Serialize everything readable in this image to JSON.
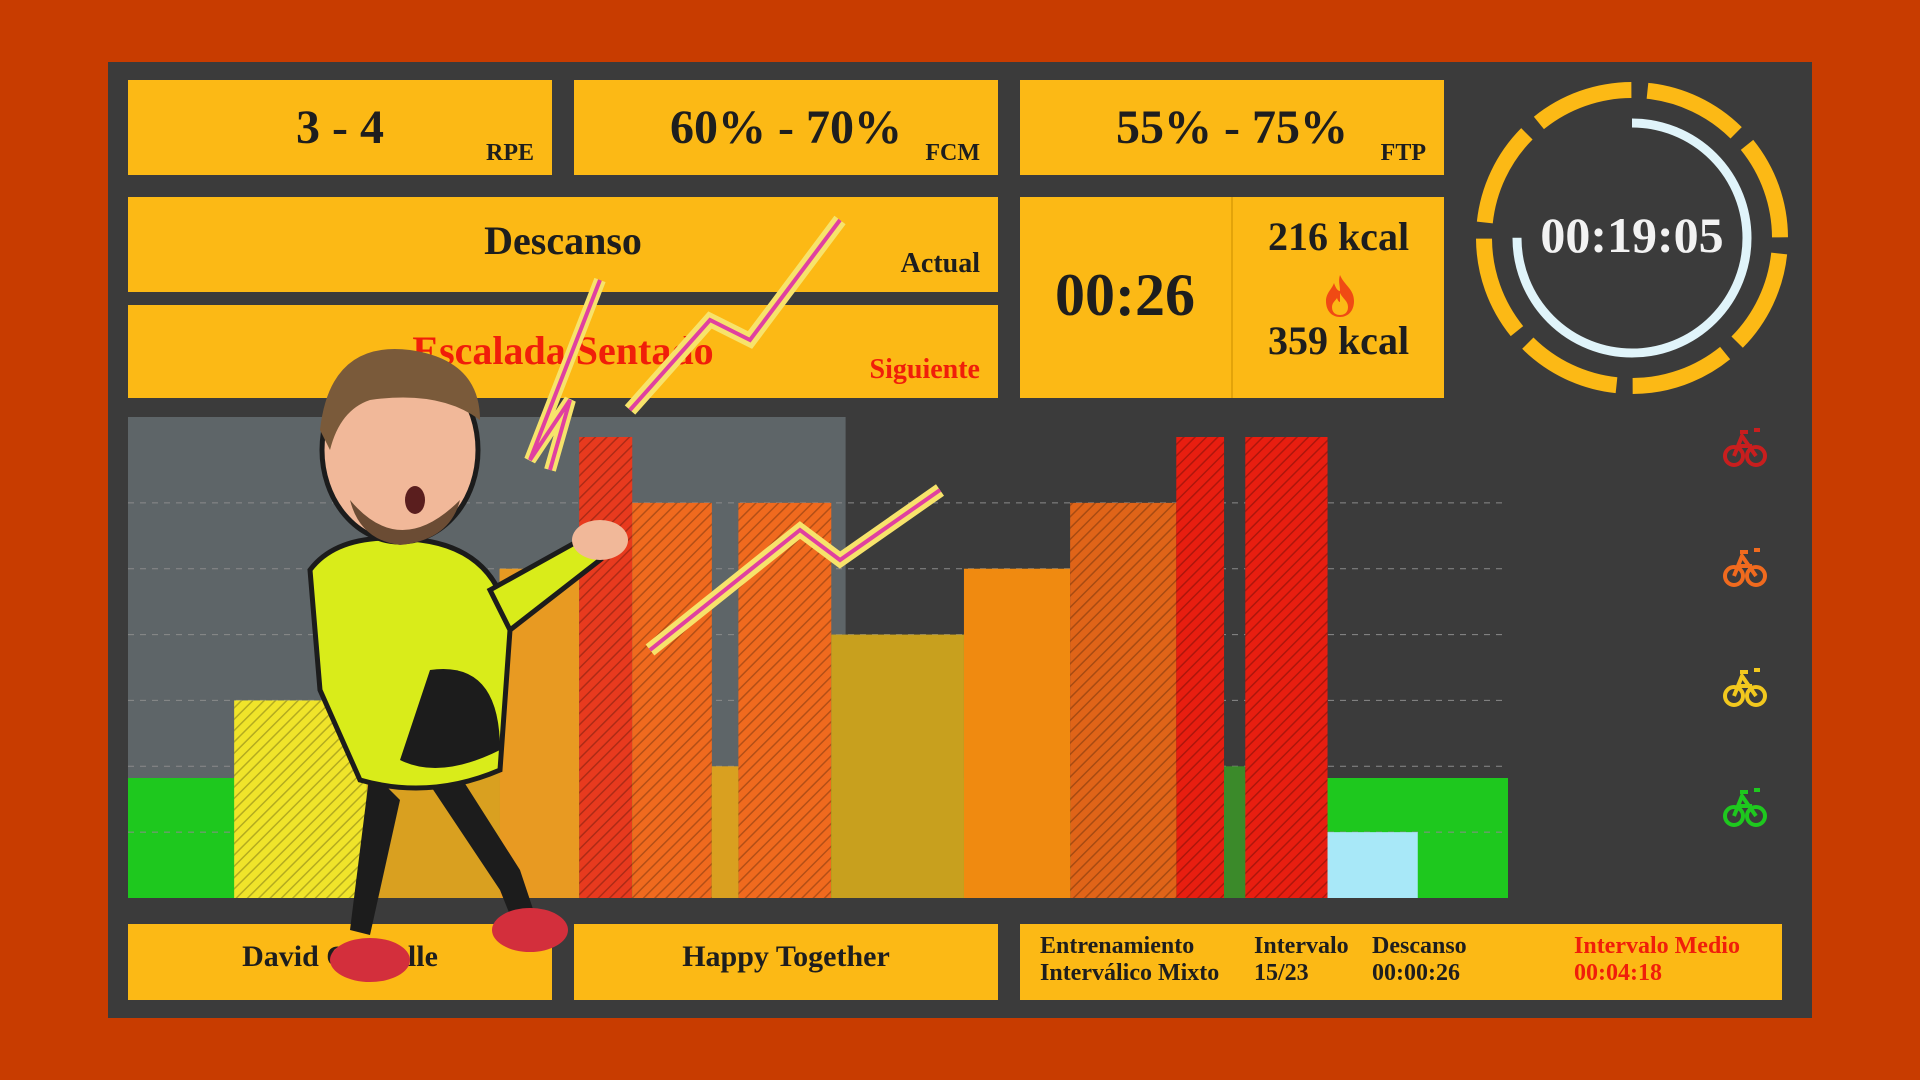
{
  "targets": {
    "rpe": {
      "value": "3 - 4",
      "unit": "RPE"
    },
    "fcm": {
      "value": "60% - 70%",
      "unit": "FCM"
    },
    "ftp": {
      "value": "55% - 75%",
      "unit": "FTP"
    }
  },
  "current": {
    "name": "Descanso",
    "label": "Actual"
  },
  "next": {
    "name": "Escalada Sentado",
    "label": "Siguiente"
  },
  "interval_timer": "00:26",
  "calories": {
    "value_1": "216 kcal",
    "value_2": "359 kcal",
    "icon": "flame-icon"
  },
  "session_timer": {
    "time": "00:19:05",
    "progress": 0.75
  },
  "footer": {
    "instructor": "David Carballe",
    "song": "Happy Together",
    "workout": {
      "line1": "Entrenamiento",
      "line2": "Interválico Mixto"
    },
    "interval": {
      "label": "Intervalo",
      "value": "15/23"
    },
    "rest": {
      "label": "Descanso",
      "value": "00:00:26"
    },
    "avg": {
      "label": "Intervalo Medio",
      "value": "00:04:18"
    }
  },
  "zones": [
    {
      "icon": "bike-icon",
      "color": "#c81e1e"
    },
    {
      "icon": "bike-icon",
      "color": "#f06a1e"
    },
    {
      "icon": "bike-icon",
      "color": "#f2c81e"
    },
    {
      "icon": "bike-icon",
      "color": "#1ec81e"
    }
  ],
  "chart_data": {
    "type": "bar",
    "ylim": [
      0,
      7
    ],
    "completed_fraction": 0.52,
    "bars": [
      {
        "start": 0,
        "end": 4,
        "value": 0,
        "fill": "#c8c8c8",
        "pattern": "none"
      },
      {
        "start": 4,
        "end": 9,
        "value": 3,
        "fill": "#f0e42a",
        "pattern": "stripe"
      },
      {
        "start": 9,
        "end": 14,
        "value": 2,
        "fill": "#d9a020",
        "pattern": "none"
      },
      {
        "start": 14,
        "end": 17,
        "value": 5,
        "fill": "#e89a22",
        "pattern": "none"
      },
      {
        "start": 17,
        "end": 19,
        "value": 7,
        "fill": "#e83a1e",
        "pattern": "stripe"
      },
      {
        "start": 19,
        "end": 22,
        "value": 6,
        "fill": "#f06a1e",
        "pattern": "stripe"
      },
      {
        "start": 22,
        "end": 23,
        "value": 2,
        "fill": "#d9a020",
        "pattern": "none"
      },
      {
        "start": 23,
        "end": 26.5,
        "value": 6,
        "fill": "#f06a1e",
        "pattern": "stripe"
      },
      {
        "start": 26.5,
        "end": 31.5,
        "value": 4,
        "fill": "#c8a01e",
        "pattern": "none"
      },
      {
        "start": 31.5,
        "end": 35.5,
        "value": 5,
        "fill": "#f08a10",
        "pattern": "none"
      },
      {
        "start": 35.5,
        "end": 39.5,
        "value": 6,
        "fill": "#e06418",
        "pattern": "stripe"
      },
      {
        "start": 39.5,
        "end": 41.3,
        "value": 7,
        "fill": "#e81e10",
        "pattern": "stripe"
      },
      {
        "start": 41.3,
        "end": 42.1,
        "value": 2,
        "fill": "#3b8a2a",
        "pattern": "none"
      },
      {
        "start": 42.1,
        "end": 45.2,
        "value": 7,
        "fill": "#e81e10",
        "pattern": "stripe"
      },
      {
        "start": 45.2,
        "end": 48.6,
        "value": 1,
        "fill": "#a8e8f8",
        "pattern": "none"
      }
    ],
    "x_max": 52
  }
}
